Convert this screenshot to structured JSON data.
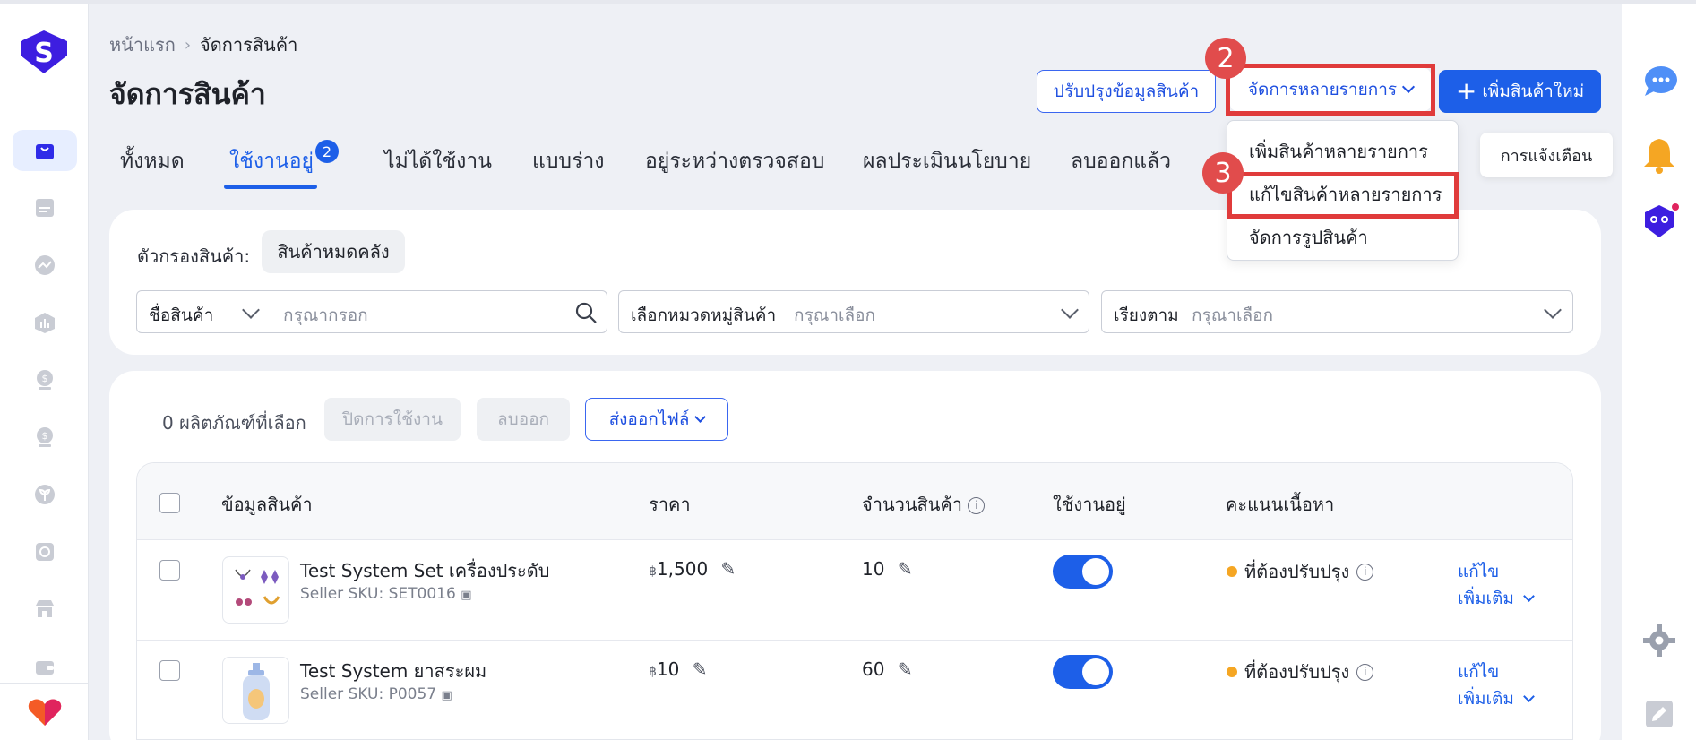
{
  "breadcrumb": {
    "home": "หน้าแรก",
    "current": "จัดการสินค้า"
  },
  "page_title": "จัดการสินค้า",
  "header_buttons": {
    "update_info": "ปรับปรุงข้อมูลสินค้า",
    "bulk_manage": "จัดการหลายรายการ",
    "add_new": "เพิ่มสินค้าใหม่"
  },
  "markers": {
    "step2": "2",
    "step3": "3"
  },
  "tabs": [
    {
      "label": "ทั้งหมด"
    },
    {
      "label": "ใช้งานอยู่",
      "badge": "2"
    },
    {
      "label": "ไม่ได้ใช้งาน"
    },
    {
      "label": "แบบร่าง"
    },
    {
      "label": "อยู่ระหว่างตรวจสอบ"
    },
    {
      "label": "ผลประเมินนโยบาย"
    },
    {
      "label": "ลบออกแล้ว"
    }
  ],
  "dropdown": {
    "items": [
      "เพิ่มสินค้าหลายรายการ",
      "แก้ไขสินค้าหลายรายการ",
      "จัดการรูปสินค้า"
    ]
  },
  "tooltip": "การแจ้งเตือน",
  "filters": {
    "label": "ตัวกรองสินค้า:",
    "chip": "สินค้าหมดคลัง",
    "search_field": "ชื่อสินค้า",
    "search_placeholder": "กรุณากรอก",
    "category_label": "เลือกหมวดหมู่สินค้า",
    "category_placeholder": "กรุณาเลือก",
    "sort_label": "เรียงตาม",
    "sort_placeholder": "กรุณาเลือก"
  },
  "bulk_bar": {
    "selected_count": "0 ผลิตภัณฑ์ที่เลือก",
    "deactivate": "ปิดการใช้งาน",
    "delete": "ลบออก",
    "export": "ส่งออกไฟล์"
  },
  "table": {
    "headers": [
      "ข้อมูลสินค้า",
      "ราคา",
      "จำนวนสินค้า",
      "ใช้งานอยู่",
      "คะแนนเนื้อหา"
    ],
    "rows": [
      {
        "name": "Test System Set เครื่องประดับ",
        "sku": "Seller SKU: SET0016",
        "currency": "฿",
        "price": "1,500",
        "qty": "10",
        "active": true,
        "score": "ที่ต้องปรับปรุง",
        "edit": "แก้ไข",
        "more": "เพิ่มเติม"
      },
      {
        "name": "Test System ยาสระผม",
        "sku": "Seller SKU: P0057",
        "currency": "฿",
        "price": "10",
        "qty": "60",
        "active": true,
        "score": "ที่ต้องปรับปรุง",
        "edit": "แก้ไข",
        "more": "เพิ่มเติม"
      }
    ]
  },
  "colors": {
    "accent": "#1d5fe8",
    "highlight": "#e03b3b",
    "warning_dot": "#f5a623"
  }
}
